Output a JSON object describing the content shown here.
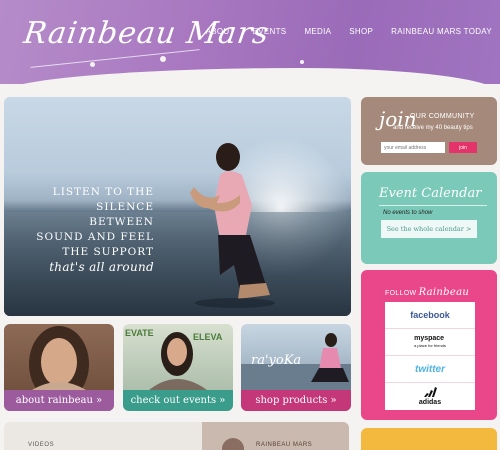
{
  "header": {
    "logo_text": "Rainbeau Mars",
    "nav": [
      "ABOUT",
      "EVENTS",
      "MEDIA",
      "SHOP",
      "RAINBEAU MARS TODAY"
    ]
  },
  "hero": {
    "lines": [
      "LISTEN TO THE",
      "SILENCE BETWEEN",
      "SOUND AND FEEL",
      "THE SUPPORT",
      "that's all around"
    ]
  },
  "cards": [
    {
      "caption": "about rainbeau »"
    },
    {
      "caption": "check out events »"
    },
    {
      "caption": "shop products »",
      "overlay_text": "ra'yoKa"
    }
  ],
  "bottom": {
    "left_label": "VIDEOS",
    "right_label": "RAINBEAU MARS"
  },
  "join": {
    "script": "join",
    "line1": "OUR COMMUNITY",
    "line2": "and receive my 40 beauty tips",
    "email_placeholder": "your email address",
    "button": "join"
  },
  "events": {
    "title": "Event Calendar",
    "empty": "No events to show",
    "button": "See the whole calendar >"
  },
  "follow": {
    "label": "FOLLOW",
    "script": "Rainbeau",
    "networks": [
      "facebook",
      "myspace",
      "twitter",
      "adidas"
    ],
    "myspace_tag": "a place for friends"
  },
  "colors": {
    "header": "#a877c0",
    "join": "#a58a7b",
    "events": "#7bc9b9",
    "follow": "#e9478a",
    "accent_pink": "#e3336a"
  }
}
